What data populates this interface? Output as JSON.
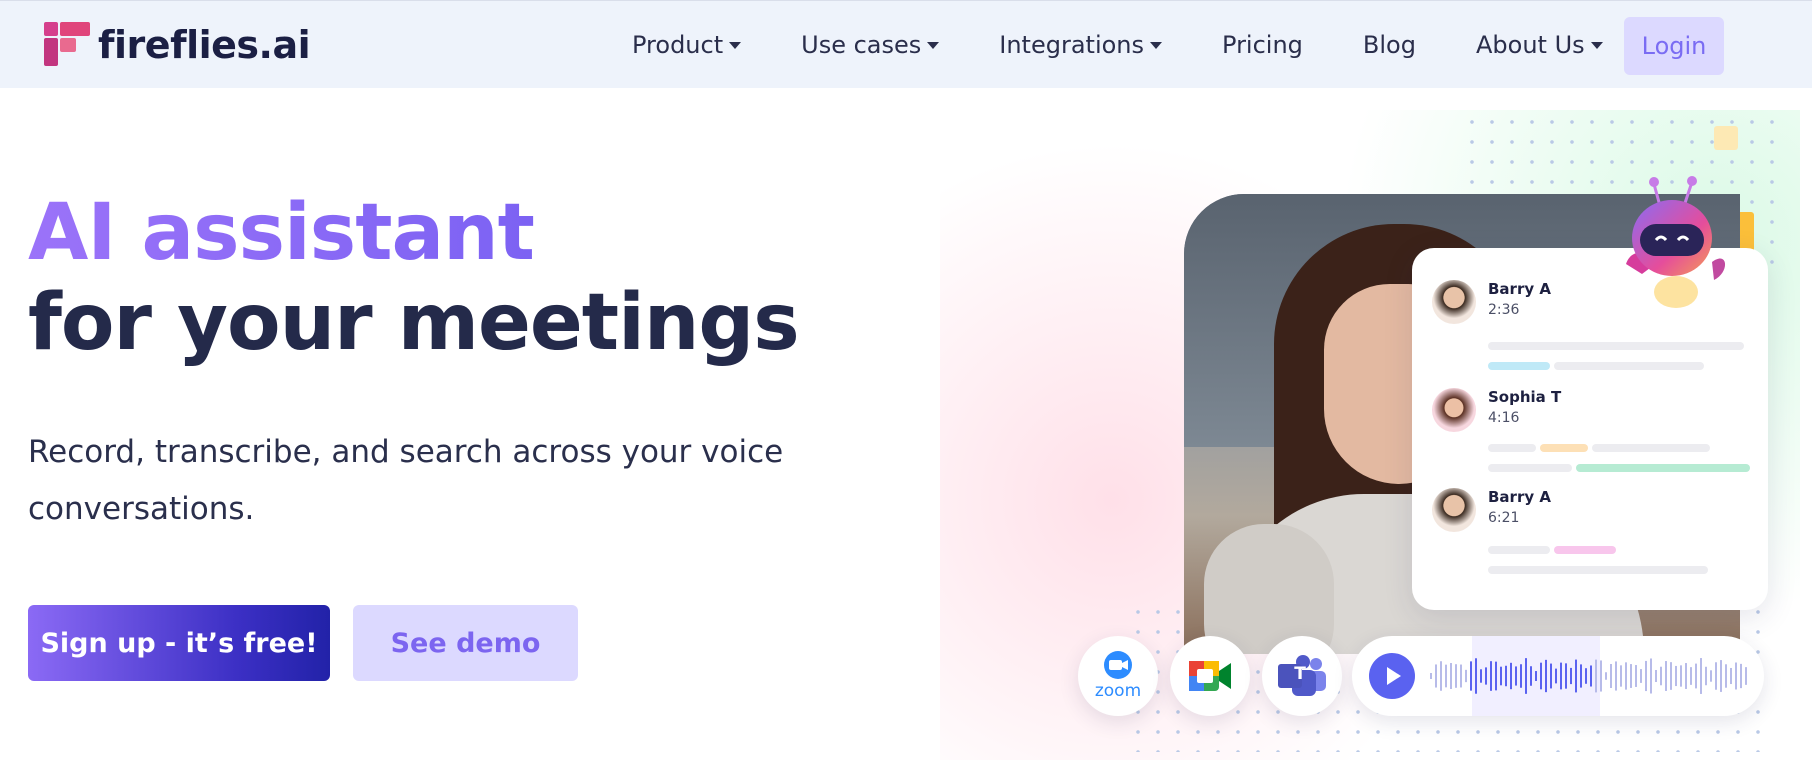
{
  "nav": {
    "brand": "fireflies.ai",
    "items": [
      {
        "label": "Product",
        "has_dropdown": true
      },
      {
        "label": "Use cases",
        "has_dropdown": true
      },
      {
        "label": "Integrations",
        "has_dropdown": true
      },
      {
        "label": "Pricing",
        "has_dropdown": false
      },
      {
        "label": "Blog",
        "has_dropdown": false
      },
      {
        "label": "About Us",
        "has_dropdown": true
      }
    ],
    "login_label": "Login"
  },
  "hero": {
    "headline_line1": "AI assistant",
    "headline_line2": "for your meetings",
    "subtext": "Record, transcribe, and search across your voice conversations.",
    "primary_cta": "Sign up - it’s free!",
    "secondary_cta": "See demo"
  },
  "transcript_card": {
    "entries": [
      {
        "name": "Barry A",
        "time": "2:36"
      },
      {
        "name": "Sophia T",
        "time": "4:16"
      },
      {
        "name": "Barry A",
        "time": "6:21"
      }
    ]
  },
  "integrations": {
    "zoom_label": "zoom",
    "teams_letter": "T"
  },
  "colors": {
    "accent_purple": "#7c62f3",
    "nav_bg": "#eef3fb",
    "dark_text": "#242a4a",
    "login_bg": "#dcd9ff"
  }
}
